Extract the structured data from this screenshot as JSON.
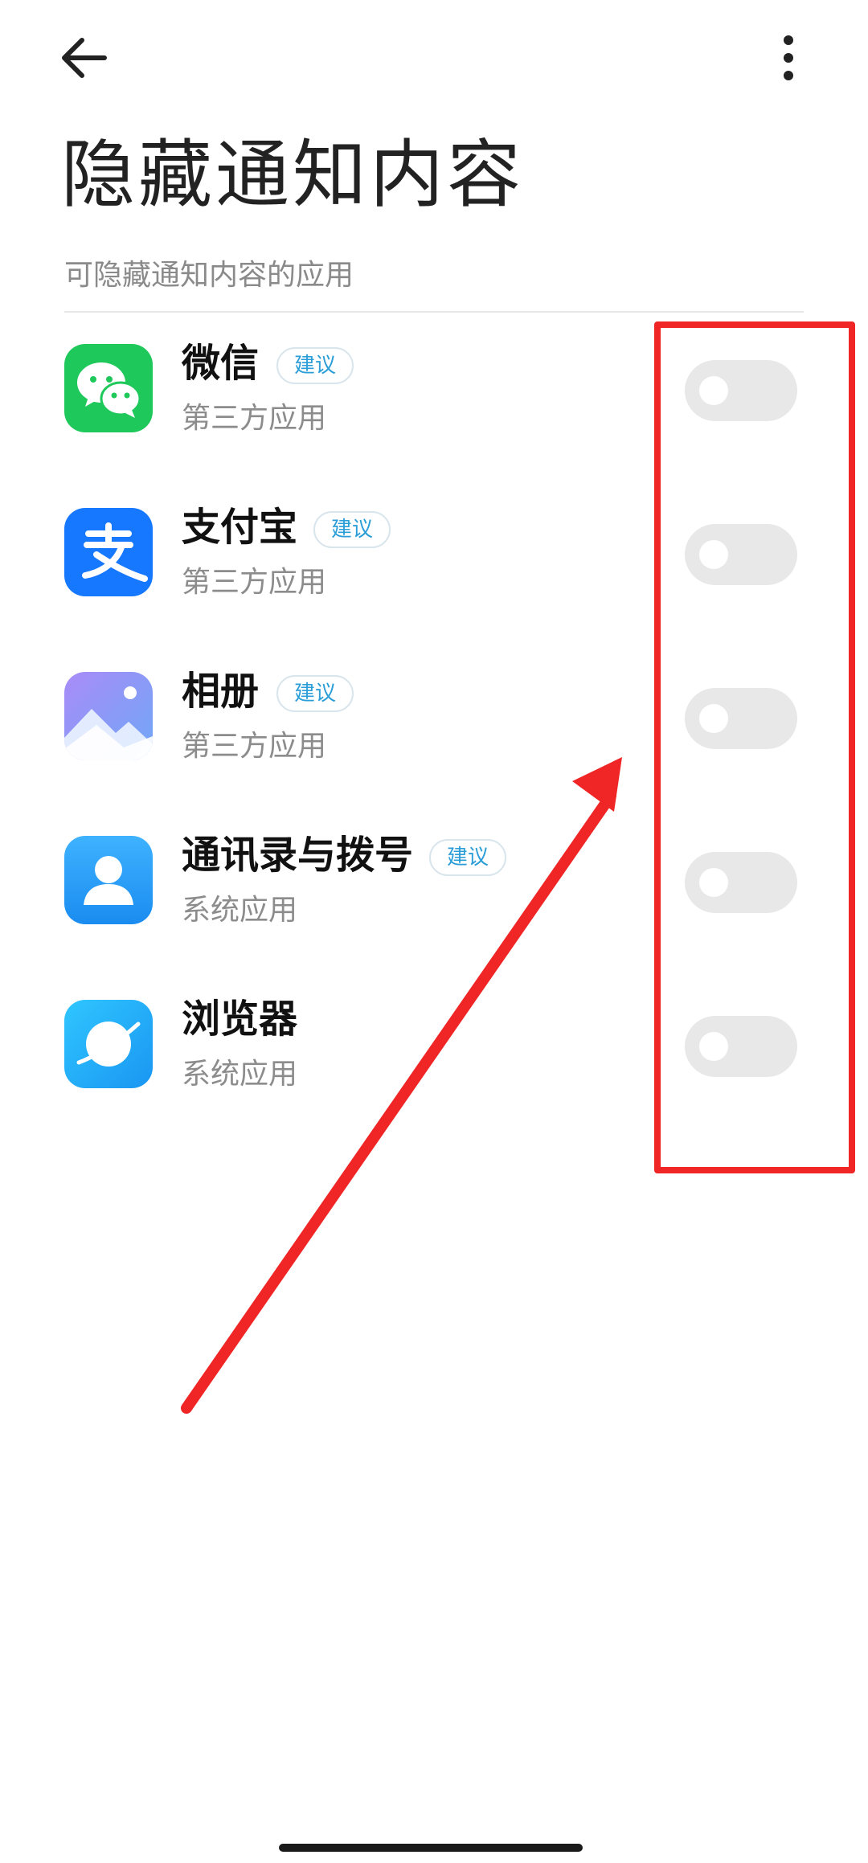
{
  "header": {
    "back_icon": "arrow-left-icon",
    "more_icon": "more-vertical-icon"
  },
  "page": {
    "title": "隐藏通知内容",
    "section_label": "可隐藏通知内容的应用"
  },
  "apps": [
    {
      "name": "微信",
      "badge": "建议",
      "type": "第三方应用",
      "icon": "wechat-icon",
      "enabled": false
    },
    {
      "name": "支付宝",
      "badge": "建议",
      "type": "第三方应用",
      "icon": "alipay-icon",
      "enabled": false
    },
    {
      "name": "相册",
      "badge": "建议",
      "type": "第三方应用",
      "icon": "gallery-icon",
      "enabled": false
    },
    {
      "name": "通讯录与拨号",
      "badge": "建议",
      "type": "系统应用",
      "icon": "contacts-icon",
      "enabled": false
    },
    {
      "name": "浏览器",
      "badge": "",
      "type": "系统应用",
      "icon": "browser-icon",
      "enabled": false
    }
  ],
  "colors": {
    "badge_text": "#2b9ed8",
    "toggle_off": "#e8e8e8",
    "annotation": "#f02525"
  }
}
